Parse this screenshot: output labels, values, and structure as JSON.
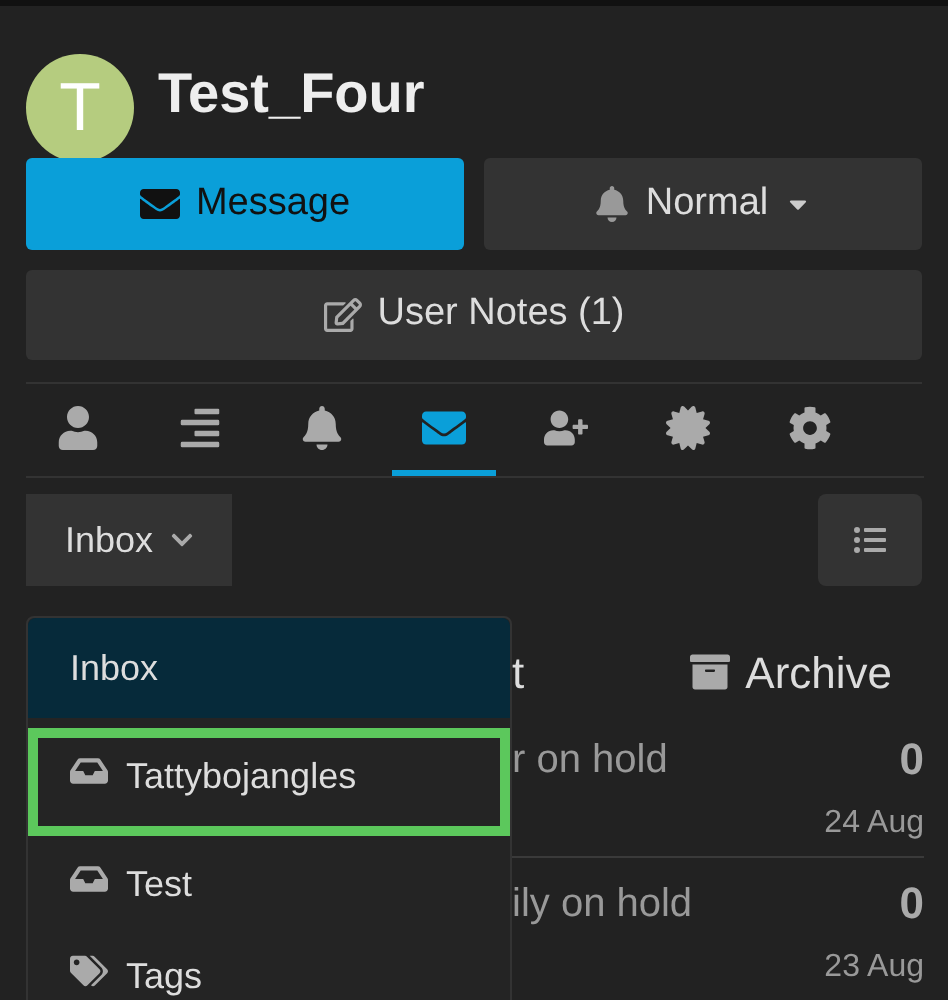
{
  "profile": {
    "avatar_letter": "T",
    "name": "Test_Four"
  },
  "actions": [
    {
      "label": "Message",
      "kind": "primary"
    },
    {
      "label": "Normal",
      "kind": "dropdown"
    }
  ],
  "user_notes": {
    "label": "User Notes (1)"
  },
  "tabs": [
    {
      "selected": false
    },
    {
      "selected": false
    },
    {
      "selected": false
    },
    {
      "selected": true
    },
    {
      "selected": false
    },
    {
      "selected": false
    },
    {
      "selected": false
    }
  ],
  "folder_select": {
    "label": "Inbox"
  },
  "background": {
    "tab_fragment": "t",
    "archive_label": "Archive",
    "rows": [
      {
        "subject": "r on hold",
        "count": "0",
        "date": "24 Aug"
      },
      {
        "subject": "ily on hold",
        "count": "0",
        "date": "23 Aug"
      }
    ]
  },
  "menu": {
    "header": "Inbox",
    "items": [
      {
        "label": "Tattybojangles",
        "kind": "folder",
        "selected": true
      },
      {
        "label": "Test",
        "kind": "folder",
        "selected": false
      },
      {
        "label": "Tags",
        "kind": "tags",
        "selected": false
      }
    ]
  }
}
